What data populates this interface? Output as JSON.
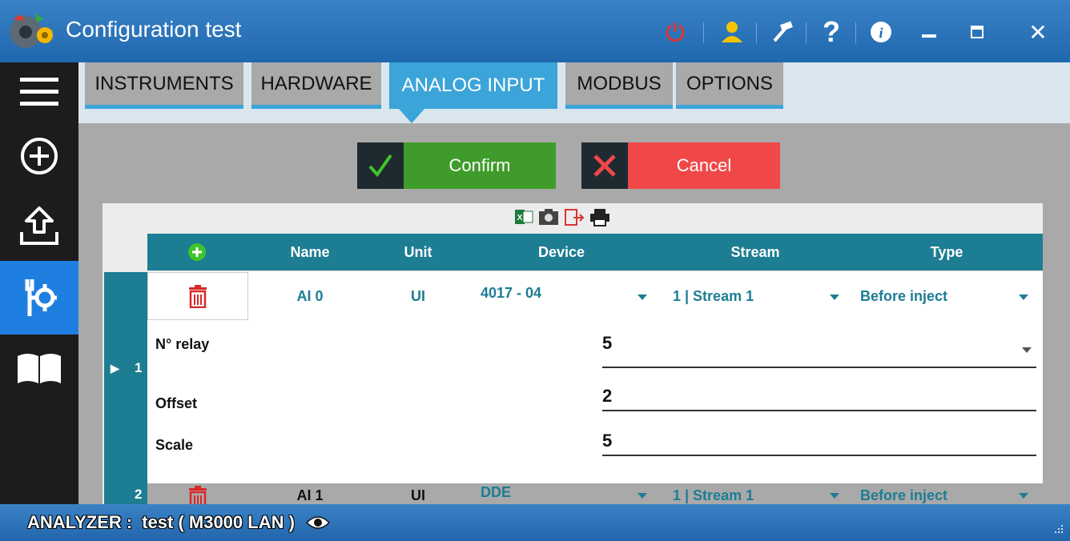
{
  "window": {
    "title": "Configuration test",
    "icons": [
      "app-gear-icon",
      "power-icon",
      "user-icon",
      "hammer-icon",
      "help-icon",
      "info-icon",
      "minimize-icon",
      "maximize-icon",
      "close-icon"
    ]
  },
  "sidebar": {
    "items": [
      {
        "icon": "menu-icon",
        "active": false
      },
      {
        "icon": "add-circle-icon",
        "active": false
      },
      {
        "icon": "upload-icon",
        "active": false
      },
      {
        "icon": "tools-icon",
        "active": true
      },
      {
        "icon": "book-icon",
        "active": false
      }
    ]
  },
  "tabs": [
    {
      "label": "INSTRUMENTS",
      "active": false
    },
    {
      "label": "HARDWARE",
      "active": false
    },
    {
      "label": "ANALOG INPUT",
      "active": true
    },
    {
      "label": "MODBUS",
      "active": false
    },
    {
      "label": "OPTIONS",
      "active": false
    }
  ],
  "actions": {
    "confirm_label": "Confirm",
    "cancel_label": "Cancel",
    "confirm_color": "#3f9c2a",
    "cancel_color": "#f04848"
  },
  "export_icons": [
    "excel-icon",
    "camera-icon",
    "export-icon",
    "print-icon"
  ],
  "table": {
    "columns": [
      "Name",
      "Unit",
      "Device",
      "Stream",
      "Type"
    ],
    "rows": [
      {
        "index": "1",
        "name": "AI 0",
        "unit": "UI",
        "device": "4017 - 04",
        "stream": "1 | Stream 1",
        "type": "Before inject",
        "expanded": true
      },
      {
        "index": "2",
        "name": "AI 1",
        "unit": "UI",
        "device": "DDE",
        "stream": "1 | Stream 1",
        "type": "Before inject",
        "expanded": false
      }
    ],
    "details": {
      "relay_label": "N° relay",
      "relay_value": "5",
      "offset_label": "Offset",
      "offset_value": "2",
      "scale_label": "Scale",
      "scale_value": "5"
    }
  },
  "status": {
    "label": "ANALYZER :",
    "value": "test ( M3000 LAN )"
  },
  "colors": {
    "titlebar": "#2f77bd",
    "sidebar": "#1c1c1c",
    "sidebar_active": "#1f7fe0",
    "tab_active": "#3ba4d9",
    "table_header": "#1d7d93"
  }
}
